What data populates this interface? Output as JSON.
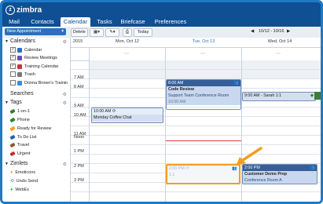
{
  "header": {
    "logo": "zimbra",
    "tabs": [
      "Mail",
      "Contacts",
      "Calendar",
      "Tasks",
      "Briefcase",
      "Preferences"
    ],
    "active_tab": "Calendar"
  },
  "toolbar": {
    "new_appointment": "New Appointment",
    "delete": "Delete",
    "today": "Today",
    "date_range": "10/12 - 10/16"
  },
  "sidebar": {
    "calendars_title": "Calendars",
    "calendars": [
      {
        "label": "Calendar",
        "checked": true,
        "color": "#2b6fbd"
      },
      {
        "label": "Review Meetings",
        "checked": true,
        "color": "#6a4bb0"
      },
      {
        "label": "Training Calendar",
        "checked": true,
        "color": "#c8343c"
      },
      {
        "label": "Trash",
        "checked": false,
        "color": "#777777"
      },
      {
        "label": "Donna Brown's Trainin",
        "checked": false,
        "color": "#3f8ad6"
      }
    ],
    "searches_title": "Searches",
    "tags_title": "Tags",
    "tags": [
      {
        "label": "1-on-1",
        "color": "#2e7d32"
      },
      {
        "label": "Phone",
        "color": "#2e7d32"
      },
      {
        "label": "Ready for Review",
        "color": "#f0a020"
      },
      {
        "label": "To Do List",
        "color": "#1f5fb0"
      },
      {
        "label": "Travel",
        "color": "#8a5a2a"
      },
      {
        "label": "Urgent",
        "color": "#c62828"
      }
    ],
    "zimlets_title": "Zimlets",
    "zimlets": [
      "Emoticons",
      "Undo Send",
      "WebEx"
    ]
  },
  "calendar": {
    "year": "2015",
    "days": [
      "Mon, Oct 12",
      "Tue, Oct 13",
      "Wed, Oct 14"
    ],
    "hours": [
      "7 AM",
      "8 AM",
      "9 AM",
      "10 AM",
      "11 AM",
      "Noon",
      "1 PM",
      "2 PM",
      "3 PM"
    ],
    "events": {
      "coffee": {
        "time": "10:00 AM",
        "title": "Monday Coffee Chat"
      },
      "code_review": {
        "time": "8:00 AM",
        "title": "Code Review",
        "location": "Support Team Conference Room",
        "end_time": "10:00 AM"
      },
      "sarah": {
        "title": "9:00 AM - Sarah 1:1"
      },
      "ghost": {
        "time": "2:00 PM",
        "sub": "1:1"
      },
      "demo": {
        "time": "2:00 PM",
        "title": "Customer Demo Prep",
        "location": "Conference Room A"
      }
    }
  },
  "colors": {
    "brand": "#0f4f94",
    "highlight": "#f0a020"
  }
}
